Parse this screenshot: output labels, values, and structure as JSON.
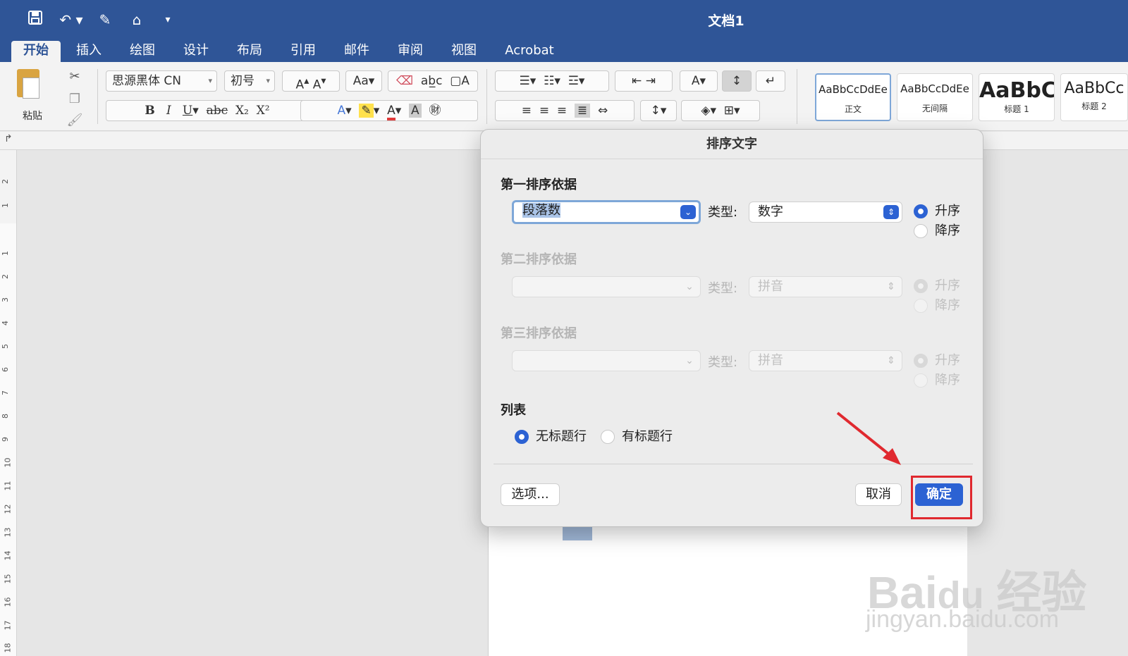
{
  "window": {
    "title": "文档1"
  },
  "quick_access": {
    "icons": [
      "save-icon",
      "undo-icon",
      "edit-icon",
      "home-icon",
      "customize-icon"
    ]
  },
  "tabs": [
    {
      "label": "开始",
      "active": true
    },
    {
      "label": "插入"
    },
    {
      "label": "绘图"
    },
    {
      "label": "设计"
    },
    {
      "label": "布局"
    },
    {
      "label": "引用"
    },
    {
      "label": "邮件"
    },
    {
      "label": "审阅"
    },
    {
      "label": "视图"
    },
    {
      "label": "Acrobat"
    }
  ],
  "ribbon": {
    "paste_label": "粘贴",
    "font_name": "思源黑体 CN",
    "font_size": "初号",
    "styles": [
      {
        "preview": "AaBbCcDdEe",
        "name": "正文"
      },
      {
        "preview": "AaBbCcDdEe",
        "name": "无间隔"
      },
      {
        "preview": "AaBbC",
        "name": "标题 1"
      },
      {
        "preview": "AaBbCc",
        "name": "标题 2"
      }
    ]
  },
  "ruler": {
    "numbers": [
      "2",
      "1",
      "1",
      "2",
      "3",
      "4",
      "5",
      "6",
      "7",
      "8",
      "9",
      "10",
      "11",
      "12",
      "13",
      "14",
      "15",
      "16",
      "17",
      "18"
    ]
  },
  "dialog": {
    "title": "排序文字",
    "type_label": "类型:",
    "first": {
      "label": "第一排序依据",
      "field": "段落数",
      "type": "数字",
      "asc": "升序",
      "desc": "降序",
      "selected": "asc"
    },
    "second": {
      "label": "第二排序依据",
      "field": "",
      "type": "拼音",
      "asc": "升序",
      "desc": "降序",
      "selected": "asc"
    },
    "third": {
      "label": "第三排序依据",
      "field": "",
      "type": "拼音",
      "asc": "升序",
      "desc": "降序",
      "selected": "asc"
    },
    "list": {
      "label": "列表",
      "no_header": "无标题行",
      "has_header": "有标题行",
      "selected": "no_header"
    },
    "buttons": {
      "options": "选项...",
      "cancel": "取消",
      "ok": "确定"
    }
  },
  "colors": {
    "title_bar": "#2f5597",
    "accent": "#2c62d3",
    "highlight_box": "#e0292f"
  }
}
